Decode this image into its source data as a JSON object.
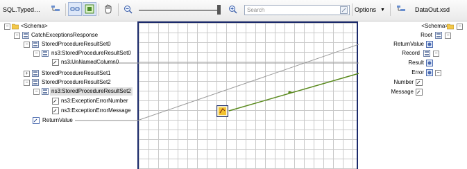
{
  "toolbar": {
    "source_title": "SQL.Typed…",
    "search_placeholder": "Search",
    "options_label": "Options",
    "destination_title": "DataOut.xsd"
  },
  "source_tree": [
    {
      "label": "<Schema>"
    },
    {
      "label": "CatchExceptionsResponse"
    },
    {
      "label": "StoredProcedureResultSet0"
    },
    {
      "label": "ns3:StoredProcedureResultSet0"
    },
    {
      "label": "ns3:UnNamedColumn0"
    },
    {
      "label": "StoredProcedureResultSet1"
    },
    {
      "label": "StoredProcedureResultSet2"
    },
    {
      "label": "ns3:StoredProcedureResultSet2"
    },
    {
      "label": "ns3:ExceptionErrorNumber"
    },
    {
      "label": "ns3:ExceptionErrorMessage"
    },
    {
      "label": "ReturnValue"
    }
  ],
  "dest_tree": [
    {
      "label": "<Schema>"
    },
    {
      "label": "Root"
    },
    {
      "label": "ReturnValue"
    },
    {
      "label": "Record"
    },
    {
      "label": "Result"
    },
    {
      "label": "Error"
    },
    {
      "label": "Number"
    },
    {
      "label": "Message"
    }
  ],
  "colors": {
    "link_gray": "#8a8a8a",
    "link_green": "#5a8a1e",
    "functoid_border": "#1b2a6b",
    "functoid_fill": "#f2c230"
  },
  "icons": [
    "folder-icon",
    "schema-node-icon",
    "field-icon",
    "hand-tool-icon",
    "zoom-out-icon",
    "zoom-in-icon",
    "search-icon",
    "functoid-icon"
  ]
}
